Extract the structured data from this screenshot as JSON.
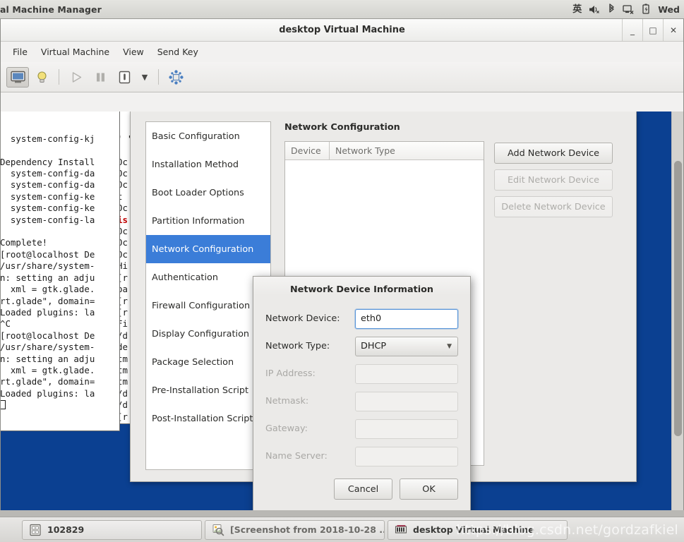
{
  "top_panel": {
    "title": "al Machine Manager",
    "tray": [
      {
        "name": "input-method-icon",
        "glyph": "英"
      },
      {
        "name": "volume-muted-icon",
        "glyph": "🔈"
      },
      {
        "name": "bluetooth-icon",
        "glyph": "ᛗ"
      },
      {
        "name": "network-disconnected-icon",
        "glyph": "▣"
      },
      {
        "name": "battery-charging-icon",
        "glyph": "▯"
      }
    ],
    "clock": "Wed"
  },
  "vmm": {
    "window_title": "desktop Virtual Machine",
    "window_buttons": {
      "minimize": "_",
      "maximize": "□",
      "close": "✕"
    },
    "menus": [
      "File",
      "Virtual Machine",
      "View",
      "Send Key"
    ],
    "toolbar": [
      {
        "name": "show-console-button",
        "glyph": "console"
      },
      {
        "name": "show-details-button",
        "glyph": "lightbulb"
      },
      {
        "name": "run-button",
        "glyph": "play"
      },
      {
        "name": "pause-button",
        "glyph": "pause"
      },
      {
        "name": "shutdown-button",
        "glyph": "power"
      },
      {
        "name": "shutdown-menu-button",
        "glyph": "chevron-down"
      },
      {
        "name": "fullscreen-button",
        "glyph": "fullscreen"
      }
    ]
  },
  "terminal_front": {
    "lines": [
      "  system-config-kj",
      "",
      "Dependency Install",
      "  system-config-da",
      "  system-config-da",
      "  system-config-ke",
      "  system-config-ke",
      "  system-config-la",
      "",
      "Complete!",
      "[root@localhost De",
      "/usr/share/system-",
      "n: setting an adju",
      "  xml = gtk.glade.",
      "rt.glade\", domain=",
      "Loaded plugins: la",
      "^C",
      "[root@localhost De",
      "/usr/share/system-",
      "n: setting an adju",
      "  xml = gtk.glade.",
      "rt.glade\", domain=",
      "Loaded plugins: la"
    ]
  },
  "terminal_back": {
    "lines": [
      "' \"",
      "",
      "Oc",
      "Oc",
      "Oc",
      "t ",
      "Oc",
      "is",
      "Oc",
      "Oc",
      "Oc",
      "Hi",
      "[r",
      "ba",
      "[r",
      "[r",
      "Fi",
      "/d",
      "de",
      "tm",
      "tm",
      "tm",
      "/d",
      "/d",
      "[r"
    ]
  },
  "kickstart": {
    "sidebar": [
      {
        "label": "Basic Configuration",
        "selected": false
      },
      {
        "label": "Installation Method",
        "selected": false
      },
      {
        "label": "Boot Loader Options",
        "selected": false
      },
      {
        "label": "Partition Information",
        "selected": false
      },
      {
        "label": "Network Configuration",
        "selected": true
      },
      {
        "label": "Authentication",
        "selected": false
      },
      {
        "label": "Firewall Configuration",
        "selected": false
      },
      {
        "label": "Display Configuration",
        "selected": false
      },
      {
        "label": "Package Selection",
        "selected": false
      },
      {
        "label": "Pre-Installation Script",
        "selected": false
      },
      {
        "label": "Post-Installation Script",
        "selected": false
      }
    ],
    "section_title": "Network Configuration",
    "table": {
      "columns": [
        "Device",
        "Network Type"
      ],
      "rows": []
    },
    "buttons": [
      {
        "label": "Add Network Device",
        "disabled": false
      },
      {
        "label": "Edit Network Device",
        "disabled": true
      },
      {
        "label": "Delete Network Device",
        "disabled": true
      }
    ]
  },
  "dialog": {
    "title": "Network Device Information",
    "fields": [
      {
        "label": "Network Device:",
        "value": "eth0",
        "type": "text",
        "disabled": false,
        "focused": true
      },
      {
        "label": "Network Type:",
        "value": "DHCP",
        "type": "select",
        "disabled": false,
        "focused": false
      },
      {
        "label": "IP Address:",
        "value": "",
        "type": "text",
        "disabled": true,
        "focused": false
      },
      {
        "label": "Netmask:",
        "value": "",
        "type": "text",
        "disabled": true,
        "focused": false
      },
      {
        "label": "Gateway:",
        "value": "",
        "type": "text",
        "disabled": true,
        "focused": false
      },
      {
        "label": "Name Server:",
        "value": "",
        "type": "text",
        "disabled": true,
        "focused": false
      }
    ],
    "cancel_label": "Cancel",
    "ok_label": "OK"
  },
  "taskbar": {
    "items": [
      {
        "label": "102829",
        "icon": "file-manager-icon",
        "dim": false
      },
      {
        "label": "[Screenshot from 2018-10-28 ...",
        "icon": "image-viewer-icon",
        "dim": true
      },
      {
        "label": "desktop Virtual Machine",
        "icon": "virt-manager-icon",
        "dim": false
      }
    ]
  },
  "watermark": "https://blog.csdn.net/gordzafkiel",
  "colors": {
    "desktop_blue": "#0b4091",
    "selection_blue": "#3b7dd8",
    "terminal_red": "#c00000",
    "panel_gray": "#d3d3cf"
  }
}
